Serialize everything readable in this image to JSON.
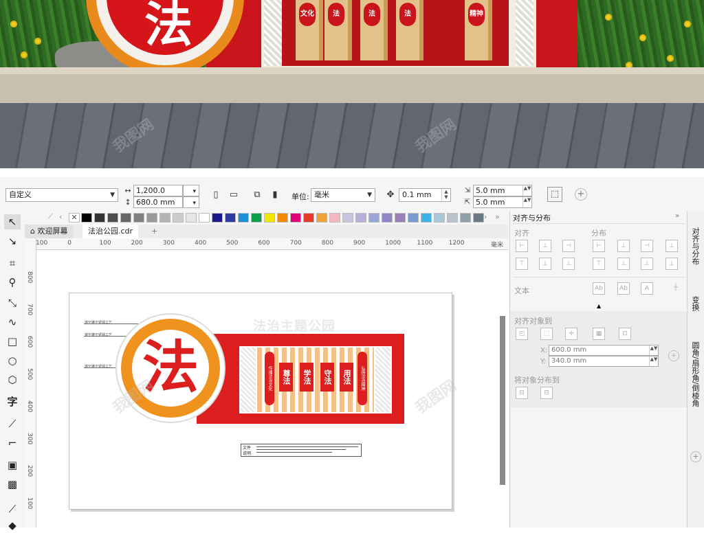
{
  "photo": {
    "seal_char": "法",
    "pillars": [
      "文化",
      "法",
      "法",
      "法",
      "精神"
    ]
  },
  "propbar": {
    "preset": "自定义",
    "width": "1,200.0 mm",
    "height": "680.0 mm",
    "unit_label": "单位:",
    "unit_value": "毫米",
    "nudge": "0.1 mm",
    "dup_x": "5.0 mm",
    "dup_y": "5.0 mm"
  },
  "tabs": {
    "welcome": "欢迎屏幕",
    "file": "法治公园.cdr"
  },
  "ruler": {
    "h_ticks": [
      "100",
      "0",
      "100",
      "200",
      "300",
      "400",
      "500",
      "600",
      "700",
      "800",
      "900",
      "1000",
      "1100",
      "1200"
    ],
    "h_unit": "毫米",
    "v_ticks": [
      "800",
      "700",
      "600",
      "500",
      "400",
      "300",
      "200",
      "100"
    ]
  },
  "artwork": {
    "faded_title": "法治主题公园",
    "seal_char": "法",
    "callouts": [
      "镂空雕不锈钢工艺",
      "镂空雕不锈钢工艺",
      "镂空雕不锈钢工艺"
    ],
    "left_pill": "传播法治文化",
    "right_pill": "弘扬法治精神",
    "words": [
      "尊法",
      "学法",
      "守法",
      "用法"
    ],
    "info_labels": [
      "文件",
      "说明"
    ]
  },
  "docker": {
    "title": "对齐与分布",
    "align_h": "对齐",
    "distribute_h": "分布",
    "text_h": "文本",
    "align_to_h": "对齐对象到",
    "x_value": "600.0 mm",
    "y_value": "340.0 mm",
    "x_label": "X:",
    "y_label": "Y:",
    "distribute_to_h": "将对象分布到"
  },
  "docker_tabs": [
    "对齐与分布",
    "变换",
    "圆角/扇形角/倒棱角"
  ],
  "palette_colors": [
    "#000000",
    "#333333",
    "#4d4d4d",
    "#666666",
    "#808080",
    "#999999",
    "#b3b3b3",
    "#cccccc",
    "#e6e6e6",
    "#ffffff",
    "#1a1a8c",
    "#2d3a9e",
    "#1e8fd6",
    "#0aa04a",
    "#f2e600",
    "#f08a00",
    "#e2007a",
    "#e8392b",
    "#f2a13a",
    "#f5b8c0",
    "#c8c4e0",
    "#b6b0d8",
    "#9aa6d6",
    "#8f88c2",
    "#9c7fb8",
    "#7a9bcf",
    "#3bb2e8",
    "#a8c8d8",
    "#b8c4cc",
    "#90a0a8",
    "#6a7a84"
  ]
}
